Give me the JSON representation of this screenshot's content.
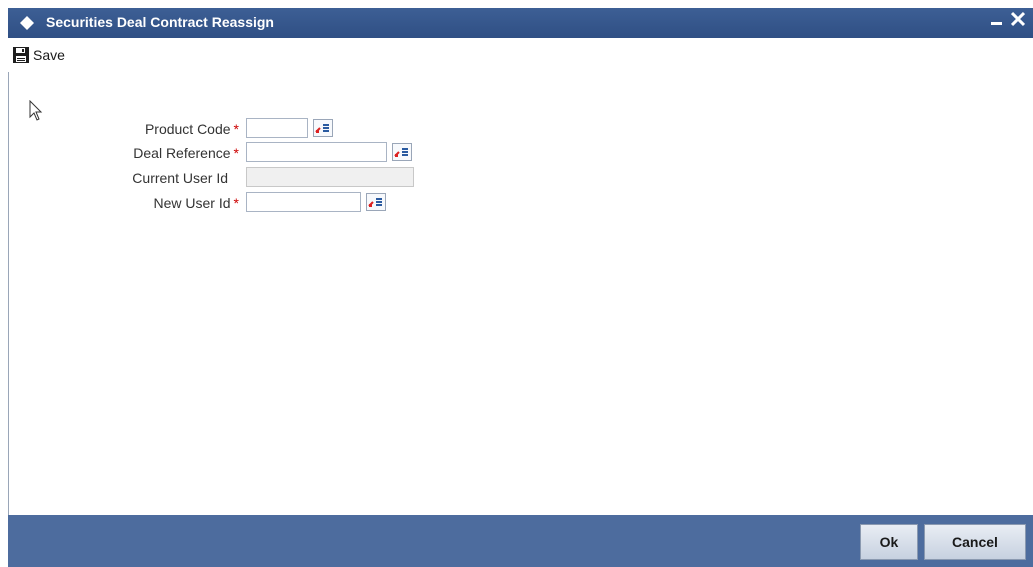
{
  "window": {
    "title": "Securities Deal Contract Reassign",
    "minimize_glyph": "‗",
    "close_glyph": "✕"
  },
  "toolbar": {
    "save_label": "Save",
    "save_icon": "floppy-disk-icon"
  },
  "form": {
    "fields": [
      {
        "label": "Product Code",
        "required": "*",
        "value": ""
      },
      {
        "label": "Deal Reference",
        "required": "*",
        "value": ""
      },
      {
        "label": "Current User Id",
        "required": "",
        "value": ""
      },
      {
        "label": "New User Id",
        "required": "*",
        "value": ""
      }
    ]
  },
  "footer": {
    "ok_label": "Ok",
    "cancel_label": "Cancel"
  },
  "colors": {
    "titlebar": "#2f4f84",
    "footer": "#4d6c9e",
    "required": "#cc0000"
  }
}
